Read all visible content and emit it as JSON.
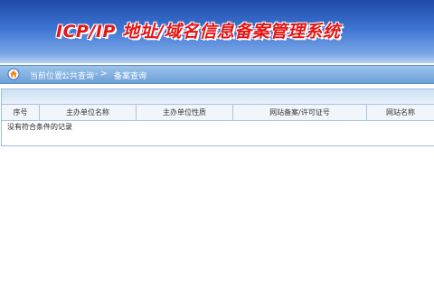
{
  "header": {
    "title": "ICP/IP 地址/域名信息备案管理系统"
  },
  "breadcrumb": {
    "icon": "home-icon",
    "prefix": "当前位置：",
    "section": "公共查询",
    "separator": "- >",
    "current": "备案查询"
  },
  "table": {
    "columns": [
      "序号",
      "主办单位名称",
      "主办单位性质",
      "网站备案/许可证号",
      "网站名称"
    ],
    "empty_message": "没有符合条件的记录"
  },
  "colors": {
    "title_red": "#e51515",
    "banner_blue": "#1f4aa8",
    "breadcrumb_blue": "#6c9fd8"
  }
}
